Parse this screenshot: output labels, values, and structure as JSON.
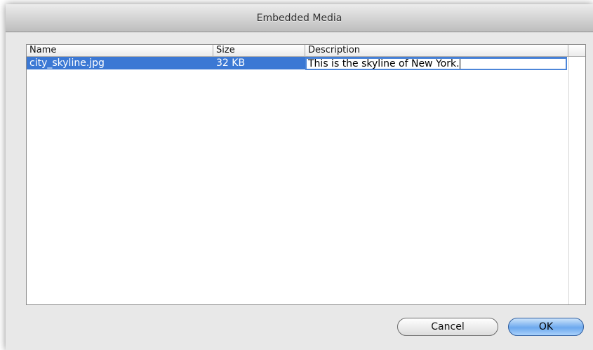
{
  "window": {
    "title": "Embedded Media"
  },
  "table": {
    "columns": [
      "Name",
      "Size",
      "Description"
    ],
    "rows": [
      {
        "name": "city_skyline.jpg",
        "size": "32 KB",
        "description": "This is the skyline of New York."
      }
    ],
    "selected_row": 0,
    "editing_column": "Description"
  },
  "buttons": {
    "cancel": "Cancel",
    "ok": "OK"
  },
  "colors": {
    "selection": "#3b78d4",
    "ok_button": "#6ca9ee"
  }
}
